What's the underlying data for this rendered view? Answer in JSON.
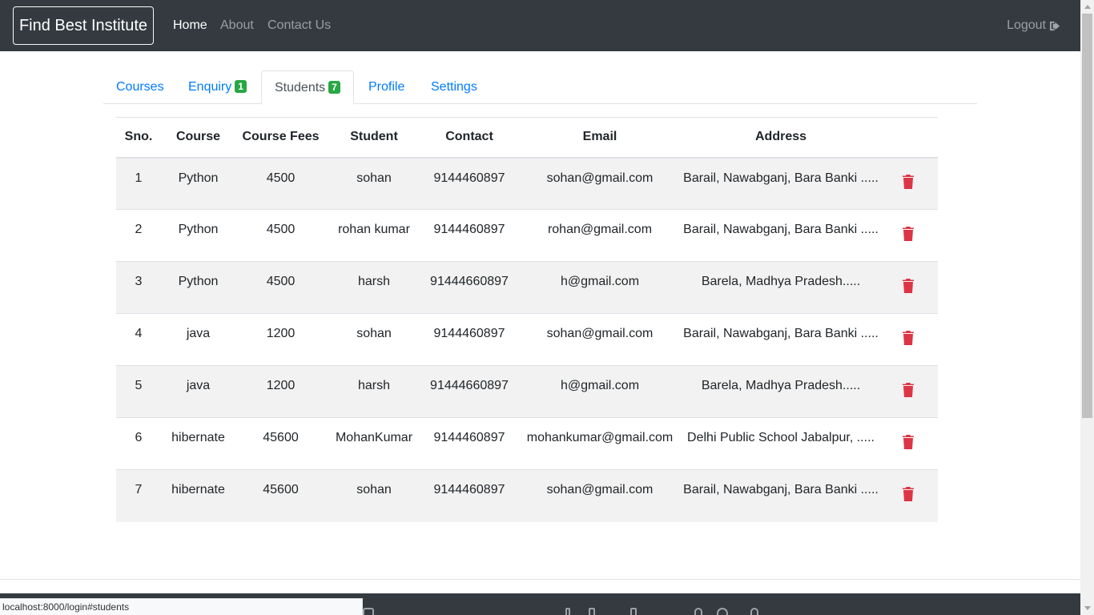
{
  "navbar": {
    "brand": "Find Best Institute",
    "links": [
      "Home",
      "About",
      "Contact Us"
    ],
    "logout": "Logout"
  },
  "tabs": [
    {
      "label": "Courses"
    },
    {
      "label": "Enquiry",
      "badge": "1"
    },
    {
      "label": "Students",
      "badge": "7"
    },
    {
      "label": "Profile"
    },
    {
      "label": "Settings"
    }
  ],
  "table": {
    "headers": [
      "Sno.",
      "Course",
      "Course Fees",
      "Student",
      "Contact",
      "Email",
      "Address"
    ],
    "rows": [
      [
        "1",
        "Python",
        "4500",
        "sohan",
        "9144460897",
        "sohan@gmail.com",
        "Barail, Nawabganj, Bara Banki ....."
      ],
      [
        "2",
        "Python",
        "4500",
        "rohan kumar",
        "9144460897",
        "rohan@gmail.com",
        "Barail, Nawabganj, Bara Banki ....."
      ],
      [
        "3",
        "Python",
        "4500",
        "harsh",
        "91444660897",
        "h@gmail.com",
        "Barela, Madhya Pradesh....."
      ],
      [
        "4",
        "java",
        "1200",
        "sohan",
        "9144460897",
        "sohan@gmail.com",
        "Barail, Nawabganj, Bara Banki ....."
      ],
      [
        "5",
        "java",
        "1200",
        "harsh",
        "91444660897",
        "h@gmail.com",
        "Barela, Madhya Pradesh....."
      ],
      [
        "6",
        "hibernate",
        "45600",
        "MohanKumar",
        "9144460897",
        "mohankumar@gmail.com",
        "Delhi Public School Jabalpur, ....."
      ],
      [
        "7",
        "hibernate",
        "45600",
        "sohan",
        "9144460897",
        "sohan@gmail.com",
        "Barail, Nawabganj, Bara Banki ....."
      ]
    ]
  },
  "status_bar": "localhost:8000/login#students",
  "colors": {
    "navbar_bg": "#343a40",
    "link": "#007bff",
    "badge": "#28a745",
    "delete": "#dc3545",
    "stripe": "#f2f2f2"
  },
  "icons": {
    "logout": "sign-out-icon",
    "delete": "trash-icon"
  }
}
